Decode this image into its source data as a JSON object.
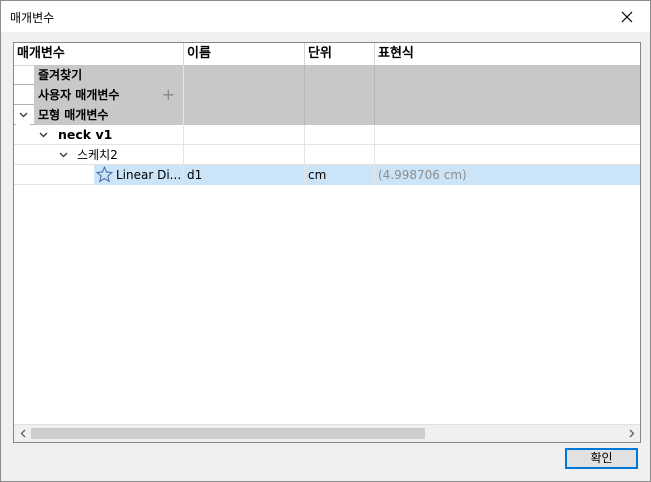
{
  "window": {
    "title": "매개변수"
  },
  "columns": [
    "매개변수",
    "이름",
    "단위",
    "표현식"
  ],
  "groups": {
    "favorites": "즐겨찾기",
    "user_params": "사용자 매개변수",
    "model_params": "모형 매개변수"
  },
  "tree": {
    "component": "neck v1",
    "sketch": "스케치2",
    "param": {
      "label": "Linear Di...",
      "name": "d1",
      "unit": "cm",
      "expression": "(4.998706 cm)"
    }
  },
  "buttons": {
    "ok": "확인"
  },
  "colors": {
    "selection": "#cce4f7",
    "group_bg": "#c8c8c8",
    "accent": "#0078d7"
  }
}
